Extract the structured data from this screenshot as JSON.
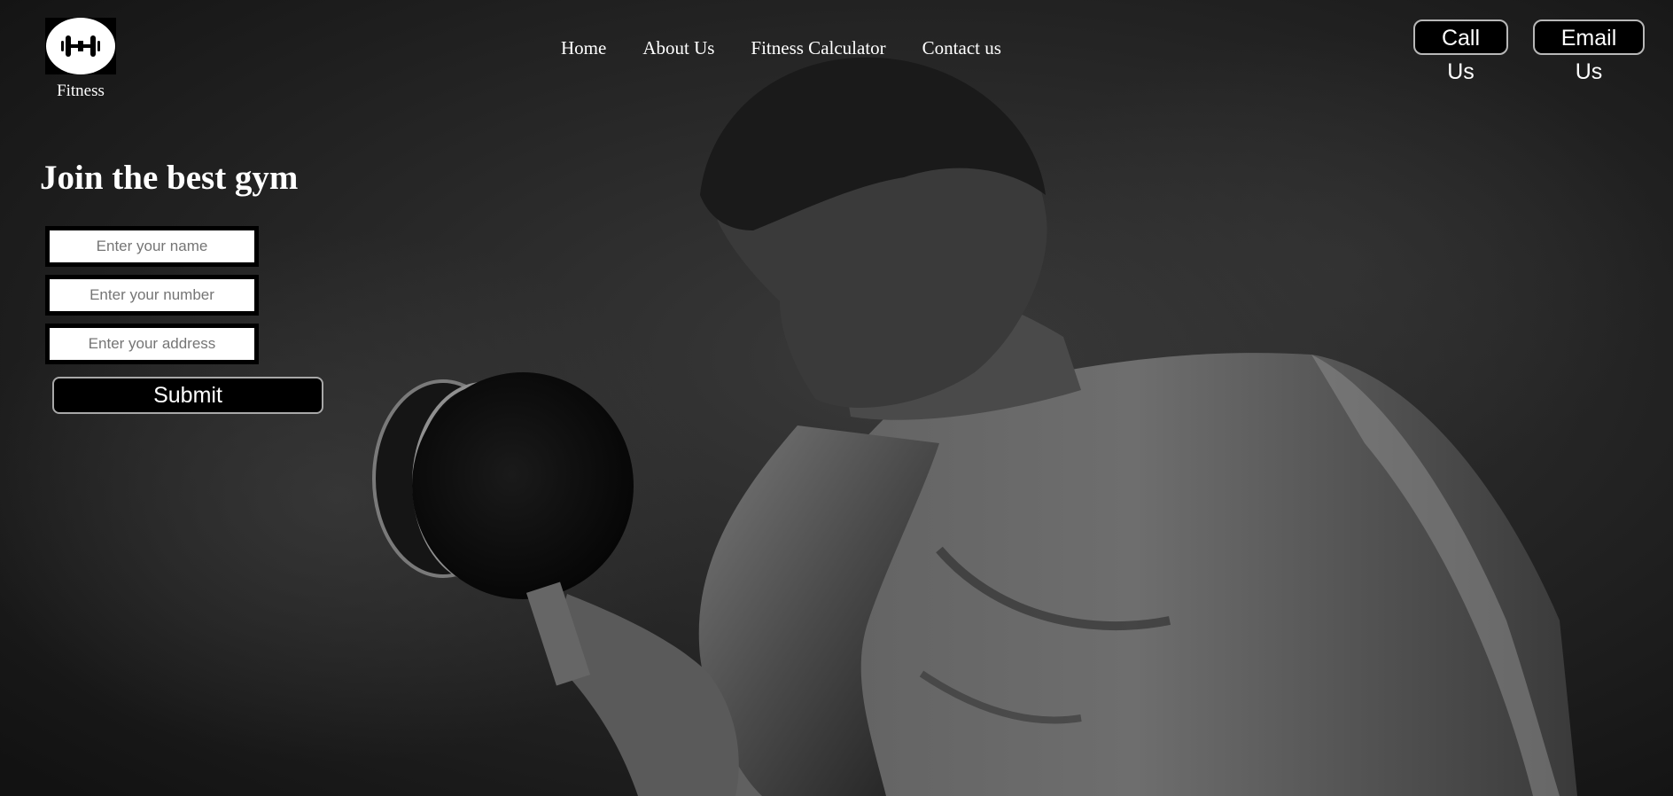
{
  "header": {
    "logo": {
      "icon": "dumbbell-icon",
      "label": "Fitness"
    },
    "nav": [
      {
        "label": "Home"
      },
      {
        "label": "About Us"
      },
      {
        "label": "Fitness Calculator"
      },
      {
        "label": "Contact us"
      }
    ],
    "actions": {
      "call_label": "Call Us",
      "email_label": "Email Us"
    }
  },
  "hero": {
    "image": "bodybuilder-dumbbell-curl-photo",
    "headline": "Join the best gym",
    "form": {
      "name_placeholder": "Enter your name",
      "number_placeholder": "Enter your number",
      "address_placeholder": "Enter your address",
      "submit_label": "Submit"
    }
  },
  "colors": {
    "background": "#151515",
    "text": "#ffffff",
    "button_bg": "#000000",
    "button_border": "#b8b8b8"
  }
}
